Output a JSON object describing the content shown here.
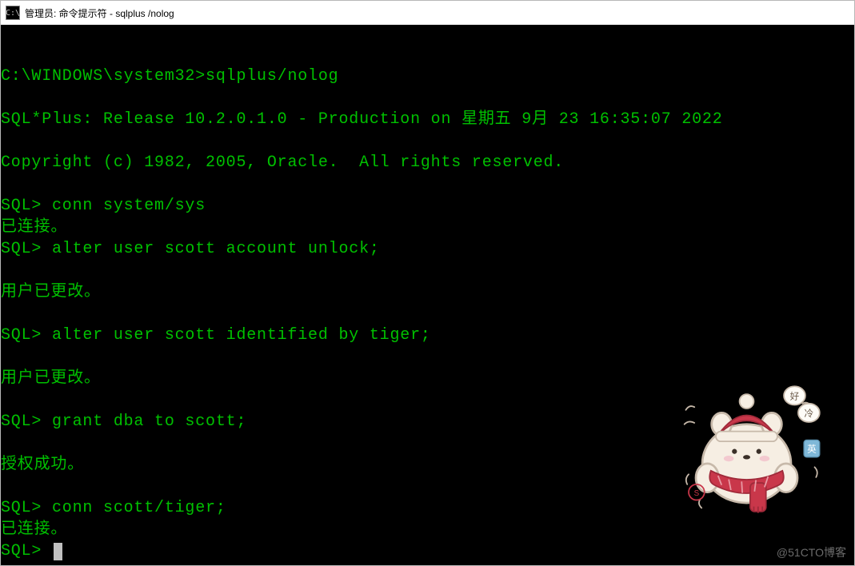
{
  "window": {
    "title": "管理员: 命令提示符 - sqlplus /nolog",
    "icon_glyph": "C:\\"
  },
  "terminal": {
    "lines": [
      "",
      "C:\\WINDOWS\\system32>sqlplus/nolog",
      "",
      "SQL*Plus: Release 10.2.0.1.0 - Production on 星期五 9月 23 16:35:07 2022",
      "",
      "Copyright (c) 1982, 2005, Oracle.  All rights reserved.",
      "",
      "SQL> conn system/sys",
      "已连接。",
      "SQL> alter user scott account unlock;",
      "",
      "用户已更改。",
      "",
      "SQL> alter user scott identified by tiger;",
      "",
      "用户已更改。",
      "",
      "SQL> grant dba to scott;",
      "",
      "授权成功。",
      "",
      "SQL> conn scott/tiger;",
      "已连接。",
      "SQL> "
    ],
    "cursor_after_last": true
  },
  "sticker": {
    "bubble_text_1": "好",
    "bubble_text_2": "冷",
    "bubble_text_3": "英",
    "hat_color": "#c9374a",
    "scarf_color": "#c9374a",
    "body_color": "#f6eee3",
    "outline": "#a88b78"
  },
  "watermark": {
    "text": "@51CTO博客"
  }
}
